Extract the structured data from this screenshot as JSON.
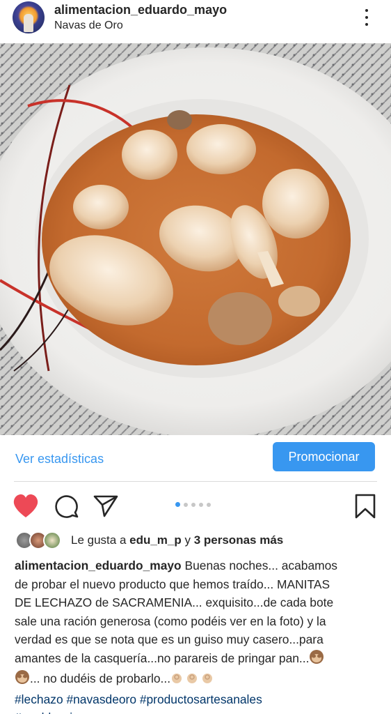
{
  "post": {
    "username": "alimentacion_eduardo_mayo",
    "location": "Navas de Oro",
    "photo_alt": "Guiso de manitas de lechazo en plato"
  },
  "actions": {
    "stats_label": "Ver estadísticas",
    "promote_label": "Promocionar",
    "carousel_count": 5,
    "carousel_active": 1
  },
  "likes": {
    "prefix": "Le gusta a ",
    "user": "edu_m_p",
    "connector": " y ",
    "others": "3 personas más"
  },
  "caption": {
    "user": "alimentacion_eduardo_mayo",
    "lines": [
      " Buenas noches... acabamos",
      "de probar el nuevo producto que hemos traído... MANITAS",
      "DE LECHAZO de SACRAMENIA... exquisito...de cada bote",
      "sale una ración generosa (como podéis ver en la foto) y la",
      "verdad es que se nota que es un guiso muy casero...para",
      "amantes de la casquería...no parareis de pringar pan..."
    ],
    "line7_text": "... no dudéis de probarlo...",
    "tags": "#lechazo #navasdeoro #productosartesanales",
    "tags2": "#pueblosvivos"
  },
  "icons": {
    "heart": "heart-icon",
    "comment": "comment-icon",
    "share": "share-icon",
    "bookmark": "bookmark-icon",
    "more": "more-options-icon",
    "heart_color": "#ed4956",
    "link_color": "#3897f0"
  }
}
